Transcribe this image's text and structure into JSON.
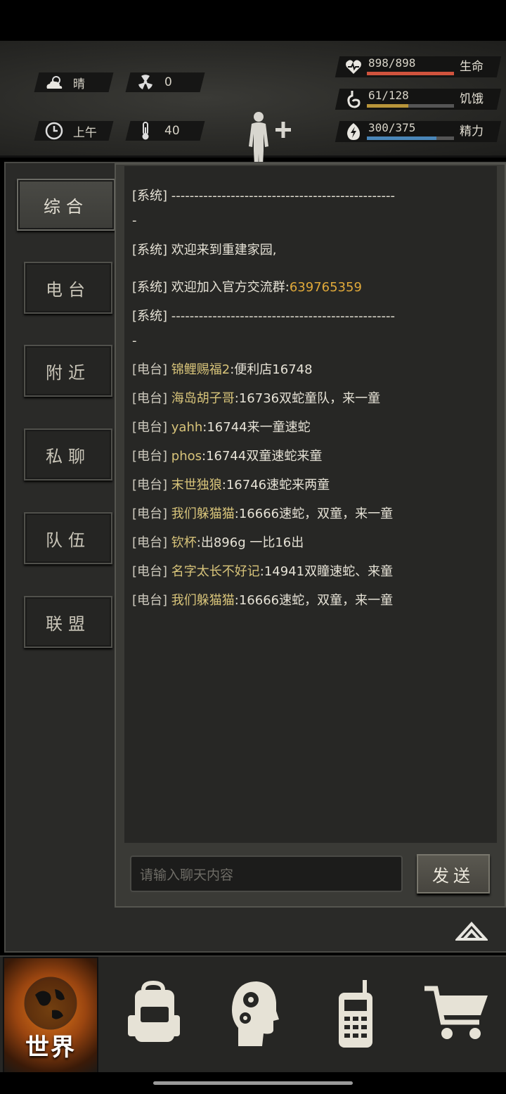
{
  "hud": {
    "weather": "晴",
    "radiation": "0",
    "time_of_day": "上午",
    "temperature": "40",
    "stats": [
      {
        "name": "生命",
        "value": "898/898",
        "current": 898,
        "max": 898,
        "color": "#d0533d",
        "icon": "heart-icon"
      },
      {
        "name": "饥饿",
        "value": "61/128",
        "current": 61,
        "max": 128,
        "color": "#b8953a",
        "icon": "stomach-icon"
      },
      {
        "name": "精力",
        "value": "300/375",
        "current": 300,
        "max": 375,
        "color": "#4a86b8",
        "icon": "energy-icon"
      }
    ]
  },
  "tabs": [
    {
      "label": "综合",
      "active": true
    },
    {
      "label": "电台",
      "active": false
    },
    {
      "label": "附近",
      "active": false
    },
    {
      "label": "私聊",
      "active": false
    },
    {
      "label": "队伍",
      "active": false
    },
    {
      "label": "联盟",
      "active": false
    }
  ],
  "chat": {
    "sys_divider_line1": "[系统] -------------------------------------------------",
    "sys_divider_line2": "-",
    "sys_welcome": "[系统] 欢迎来到重建家园,",
    "sys_group_prefix": "[系统]  欢迎加入官方交流群:",
    "sys_group_number": "639765359",
    "radio_messages": [
      {
        "channel": "[电台]",
        "name": "锦鲤赐福2",
        "text": ":便利店16748"
      },
      {
        "channel": "[电台]",
        "name": "海岛胡子哥",
        "text": ":16736双蛇童队，来一童"
      },
      {
        "channel": "[电台]",
        "name": "yahh",
        "text": ":16744来一童速蛇"
      },
      {
        "channel": "[电台]",
        "name": "phos",
        "text": ":16744双童速蛇来童"
      },
      {
        "channel": "[电台]",
        "name": "末世独狼",
        "text": ":16746速蛇来两童"
      },
      {
        "channel": "[电台]",
        "name": "我们躲猫猫",
        "text": ":16666速蛇，双童，来一童"
      },
      {
        "channel": "[电台]",
        "name": "钦杯",
        "text": ":出896g 一比16出"
      },
      {
        "channel": "[电台]",
        "name": "名字太长不好记",
        "text": ":14941双瞳速蛇、来童"
      },
      {
        "channel": "[电台]",
        "name": "我们躲猫猫",
        "text": ":16666速蛇，双童，来一童"
      }
    ],
    "input_placeholder": "请输入聊天内容",
    "send_label": "发送"
  },
  "nav": {
    "world_label": "世界",
    "items": [
      "globe-icon",
      "backpack-icon",
      "skills-head-icon",
      "radio-icon",
      "cart-icon"
    ]
  }
}
